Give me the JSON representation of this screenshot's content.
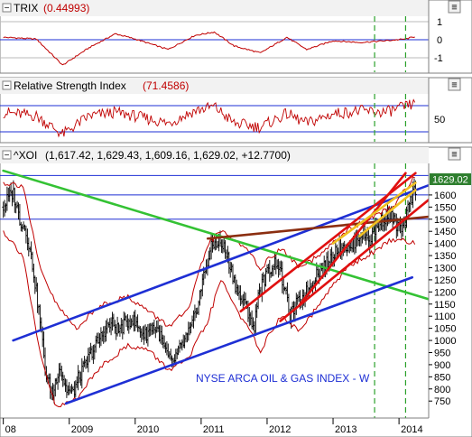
{
  "panels": {
    "trix": {
      "name": "TRIX",
      "value": "(0.44993)",
      "ticks": [
        "1",
        "0",
        "-1"
      ]
    },
    "rsi": {
      "name": "Relative Strength Index",
      "value": "(71.4586)",
      "ticks": [
        "50"
      ]
    },
    "price": {
      "name": "^XOI",
      "ohlc": "(1,617.42, 1,629.43, 1,609.16, 1,629.02, +12.7700)",
      "last_price": "1629.02",
      "annotation": "NYSE ARCA OIL & GAS INDEX - W"
    }
  },
  "controls": {
    "minus_glyph": "−",
    "menu_glyph": "≡"
  },
  "colors": {
    "price_bars": "#000000",
    "bollinger": "#c00000",
    "trix_line": "#c00000",
    "rsi_line": "#c00000",
    "channel_blue": "#1e2fd4",
    "trend_green": "#34c234",
    "channel_red": "#e01010",
    "resistance_brown": "#8b2e10",
    "fan_yellow": "#f0c020",
    "marker_green": "#2aa02a",
    "last_price_badge": "#2f7f2f"
  },
  "chart_data": [
    {
      "type": "line",
      "title": "TRIX",
      "series": [
        {
          "name": "TRIX",
          "x": [
            2008.0,
            2008.5,
            2008.9,
            2009.3,
            2009.7,
            2010.0,
            2010.5,
            2010.9,
            2011.2,
            2011.5,
            2011.9,
            2012.3,
            2012.6,
            2013.0,
            2013.4,
            2013.8,
            2014.1,
            2014.25
          ],
          "y": [
            0.4,
            0.3,
            -1.2,
            -0.2,
            0.6,
            0.3,
            -0.3,
            0.5,
            0.7,
            -0.1,
            -0.5,
            0.4,
            -0.3,
            0.2,
            0.1,
            0.2,
            0.3,
            0.45
          ]
        }
      ],
      "ylim": [
        -1.5,
        1.5
      ],
      "yticks": [
        1,
        0,
        -1
      ],
      "ref_lines": [
        0
      ]
    },
    {
      "type": "line",
      "title": "Relative Strength Index",
      "series": [
        {
          "name": "Relative Strength Index",
          "x": [
            2008.0,
            2008.5,
            2008.9,
            2009.3,
            2009.7,
            2010.0,
            2010.5,
            2010.9,
            2011.2,
            2011.5,
            2011.9,
            2012.3,
            2012.6,
            2013.0,
            2013.4,
            2013.8,
            2014.1,
            2014.25
          ],
          "y": [
            60,
            55,
            30,
            55,
            60,
            55,
            45,
            62,
            68,
            45,
            40,
            58,
            45,
            58,
            62,
            60,
            68,
            71.46
          ]
        }
      ],
      "ylim": [
        20,
        85
      ],
      "yticks": [
        50
      ],
      "ref_lines": [
        70,
        30
      ]
    },
    {
      "type": "ohlc",
      "title": "^XOI",
      "x_ticks": [
        "08",
        "2009",
        "2010",
        "2011",
        "2012",
        "2013",
        "2014"
      ],
      "x_tick_values": [
        2008,
        2009,
        2010,
        2011,
        2012,
        2013,
        2014
      ],
      "xlim": [
        2007.95,
        2014.45
      ],
      "ylim": [
        680,
        1730
      ],
      "y_ticks": [
        "1600",
        "1550",
        "1500",
        "1450",
        "1400",
        "1350",
        "1300",
        "1250",
        "1200",
        "1150",
        "1100",
        "1050",
        "1000",
        "950",
        "900",
        "850",
        "800",
        "750"
      ],
      "y_tick_values": [
        1600,
        1550,
        1500,
        1450,
        1400,
        1350,
        1300,
        1250,
        1200,
        1150,
        1100,
        1050,
        1000,
        950,
        900,
        850,
        800,
        750
      ],
      "horizontal_levels": [
        1680,
        1600,
        1500
      ],
      "close_path": [
        [
          2008.0,
          1550
        ],
        [
          2008.08,
          1590
        ],
        [
          2008.15,
          1610
        ],
        [
          2008.25,
          1500
        ],
        [
          2008.35,
          1450
        ],
        [
          2008.45,
          1300
        ],
        [
          2008.55,
          1100
        ],
        [
          2008.65,
          850
        ],
        [
          2008.75,
          780
        ],
        [
          2008.85,
          900
        ],
        [
          2008.95,
          800
        ],
        [
          2009.05,
          780
        ],
        [
          2009.15,
          850
        ],
        [
          2009.25,
          900
        ],
        [
          2009.35,
          960
        ],
        [
          2009.45,
          1000
        ],
        [
          2009.55,
          1050
        ],
        [
          2009.65,
          1070
        ],
        [
          2009.75,
          1040
        ],
        [
          2009.85,
          1070
        ],
        [
          2009.95,
          1090
        ],
        [
          2010.05,
          1050
        ],
        [
          2010.15,
          1020
        ],
        [
          2010.25,
          1060
        ],
        [
          2010.35,
          1040
        ],
        [
          2010.45,
          960
        ],
        [
          2010.55,
          900
        ],
        [
          2010.65,
          950
        ],
        [
          2010.75,
          1000
        ],
        [
          2010.85,
          1050
        ],
        [
          2010.95,
          1150
        ],
        [
          2011.05,
          1280
        ],
        [
          2011.15,
          1380
        ],
        [
          2011.25,
          1410
        ],
        [
          2011.35,
          1380
        ],
        [
          2011.45,
          1300
        ],
        [
          2011.55,
          1200
        ],
        [
          2011.65,
          1150
        ],
        [
          2011.75,
          1100
        ],
        [
          2011.8,
          1020
        ],
        [
          2011.85,
          1180
        ],
        [
          2011.95,
          1250
        ],
        [
          2012.05,
          1300
        ],
        [
          2012.15,
          1330
        ],
        [
          2012.25,
          1230
        ],
        [
          2012.35,
          1100
        ],
        [
          2012.45,
          1150
        ],
        [
          2012.55,
          1180
        ],
        [
          2012.65,
          1220
        ],
        [
          2012.75,
          1280
        ],
        [
          2012.85,
          1300
        ],
        [
          2012.95,
          1330
        ],
        [
          2013.05,
          1380
        ],
        [
          2013.15,
          1400
        ],
        [
          2013.25,
          1370
        ],
        [
          2013.35,
          1420
        ],
        [
          2013.45,
          1450
        ],
        [
          2013.55,
          1410
        ],
        [
          2013.65,
          1460
        ],
        [
          2013.75,
          1500
        ],
        [
          2013.85,
          1520
        ],
        [
          2013.95,
          1480
        ],
        [
          2014.05,
          1450
        ],
        [
          2014.12,
          1520
        ],
        [
          2014.2,
          1600
        ],
        [
          2014.25,
          1629.02
        ]
      ],
      "bollinger_upper": [
        [
          2008.0,
          1650
        ],
        [
          2008.3,
          1640
        ],
        [
          2008.55,
          1300
        ],
        [
          2008.8,
          1150
        ],
        [
          2009.1,
          1050
        ],
        [
          2009.5,
          1150
        ],
        [
          2009.9,
          1180
        ],
        [
          2010.2,
          1120
        ],
        [
          2010.5,
          1060
        ],
        [
          2010.8,
          1120
        ],
        [
          2011.1,
          1400
        ],
        [
          2011.3,
          1450
        ],
        [
          2011.6,
          1400
        ],
        [
          2011.9,
          1300
        ],
        [
          2012.2,
          1380
        ],
        [
          2012.5,
          1300
        ],
        [
          2012.8,
          1350
        ],
        [
          2013.2,
          1450
        ],
        [
          2013.6,
          1510
        ],
        [
          2013.9,
          1550
        ],
        [
          2014.25,
          1680
        ]
      ],
      "bollinger_lower": [
        [
          2008.0,
          1450
        ],
        [
          2008.3,
          1350
        ],
        [
          2008.55,
          950
        ],
        [
          2008.8,
          720
        ],
        [
          2009.1,
          760
        ],
        [
          2009.5,
          900
        ],
        [
          2009.9,
          980
        ],
        [
          2010.2,
          960
        ],
        [
          2010.5,
          880
        ],
        [
          2010.8,
          920
        ],
        [
          2011.1,
          1080
        ],
        [
          2011.3,
          1250
        ],
        [
          2011.6,
          1100
        ],
        [
          2011.9,
          960
        ],
        [
          2012.2,
          1100
        ],
        [
          2012.5,
          1040
        ],
        [
          2012.8,
          1150
        ],
        [
          2013.2,
          1300
        ],
        [
          2013.6,
          1360
        ],
        [
          2013.9,
          1420
        ],
        [
          2014.25,
          1400
        ]
      ],
      "trend_lines": [
        {
          "color_key": "trend_green",
          "points": [
            [
              2008.0,
              1700
            ],
            [
              2014.45,
              1170
            ]
          ]
        },
        {
          "color_key": "channel_blue",
          "points": [
            [
              2008.15,
              1000
            ],
            [
              2014.45,
              1640
            ]
          ]
        },
        {
          "color_key": "channel_blue",
          "points": [
            [
              2008.95,
              740
            ],
            [
              2014.2,
              1260
            ]
          ]
        },
        {
          "color_key": "resistance_brown",
          "points": [
            [
              2011.1,
              1420
            ],
            [
              2014.45,
              1510
            ]
          ]
        },
        {
          "color_key": "channel_red",
          "points": [
            [
              2011.6,
              1120
            ],
            [
              2014.25,
              1690
            ]
          ]
        },
        {
          "color_key": "channel_red",
          "points": [
            [
              2012.2,
              1080
            ],
            [
              2014.45,
              1580
            ]
          ]
        },
        {
          "color_key": "channel_red",
          "points": [
            [
              2012.5,
              1150
            ],
            [
              2014.1,
              1690
            ]
          ]
        },
        {
          "color_key": "fan_yellow",
          "points": [
            [
              2013.0,
              1400
            ],
            [
              2014.25,
              1650
            ]
          ]
        },
        {
          "color_key": "fan_yellow",
          "points": [
            [
              2013.4,
              1430
            ],
            [
              2014.25,
              1620
            ]
          ]
        }
      ],
      "vertical_markers": [
        2013.63,
        2014.1
      ]
    }
  ]
}
